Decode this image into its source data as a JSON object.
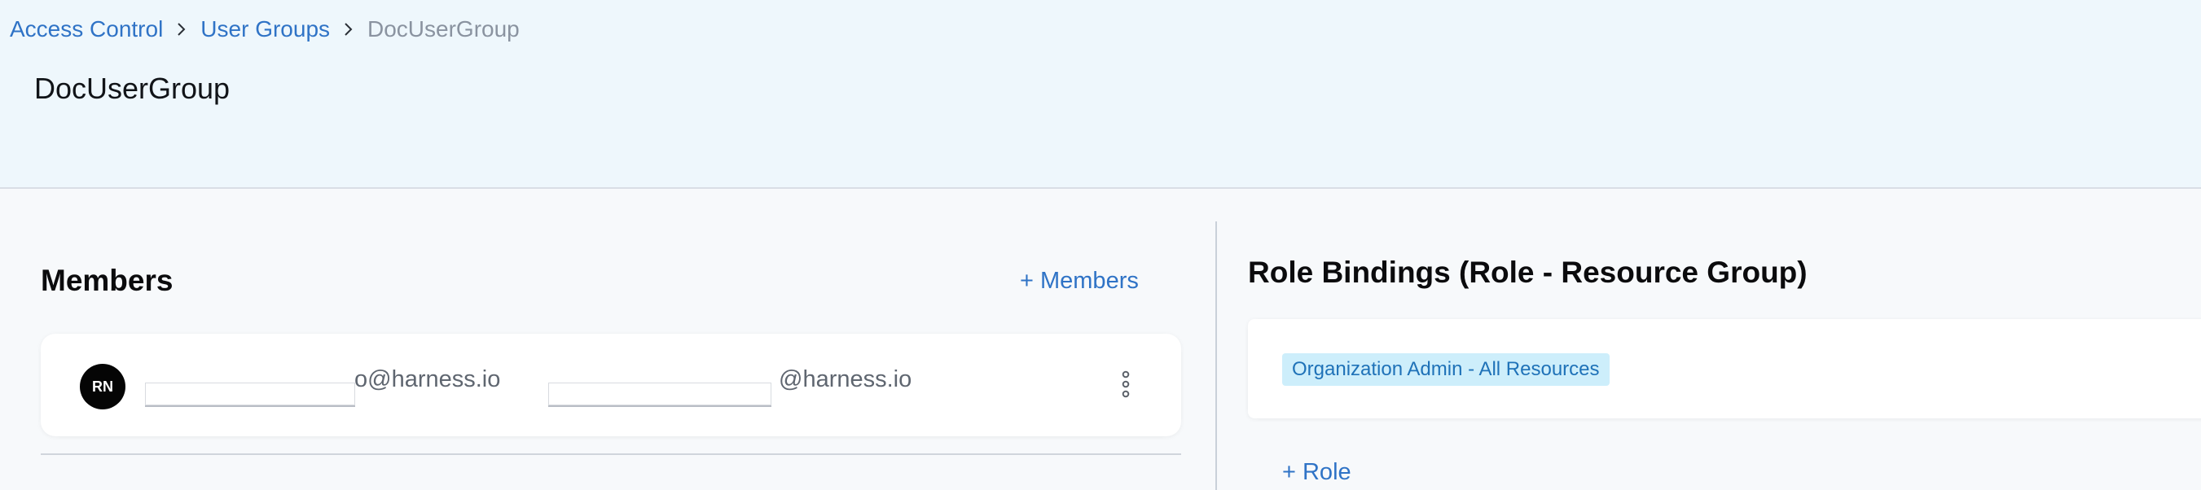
{
  "breadcrumb": {
    "items": [
      "Access Control",
      "User Groups"
    ],
    "current": "DocUserGroup"
  },
  "page": {
    "title": "DocUserGroup"
  },
  "members": {
    "title": "Members",
    "add_label": "+ Members",
    "items": [
      {
        "initials": "RN",
        "email_primary_suffix": "o@harness.io",
        "email_secondary_suffix": "@harness.io"
      }
    ]
  },
  "role_bindings": {
    "title": "Role Bindings (Role - Resource Group)",
    "items": [
      "Organization Admin - All Resources"
    ],
    "add_label": "+ Role"
  },
  "colors": {
    "link": "#2f73c6",
    "header_bg": "#eef7fc",
    "badge_bg": "#cdeefb",
    "badge_text": "#1f72b8"
  },
  "icons": {
    "breadcrumb_separator": "chevron-right-icon",
    "member_menu": "more-vertical-icon"
  }
}
